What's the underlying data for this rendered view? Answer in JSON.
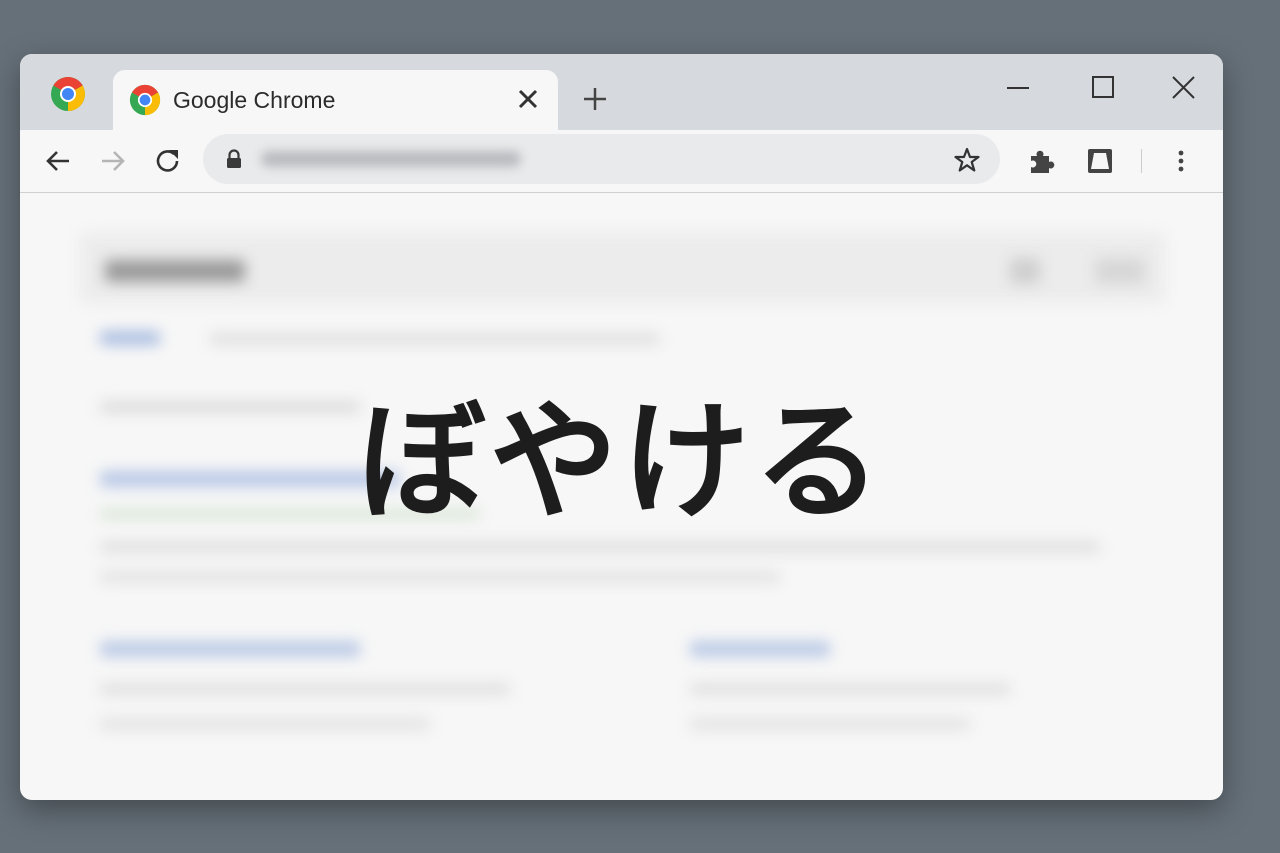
{
  "tab": {
    "title": "Google Chrome"
  },
  "overlay": {
    "text": "ぼやける"
  },
  "icons": {
    "browser_logo": "chrome-logo",
    "back": "arrow-left",
    "forward": "arrow-right",
    "reload": "reload",
    "lock": "lock",
    "bookmark": "star",
    "extensions": "puzzle",
    "side_panel": "side-panel",
    "menu": "three-dots"
  },
  "colors": {
    "frame": "#d6d9dd",
    "background": "#667079",
    "omnibox": "#e9eaec"
  }
}
